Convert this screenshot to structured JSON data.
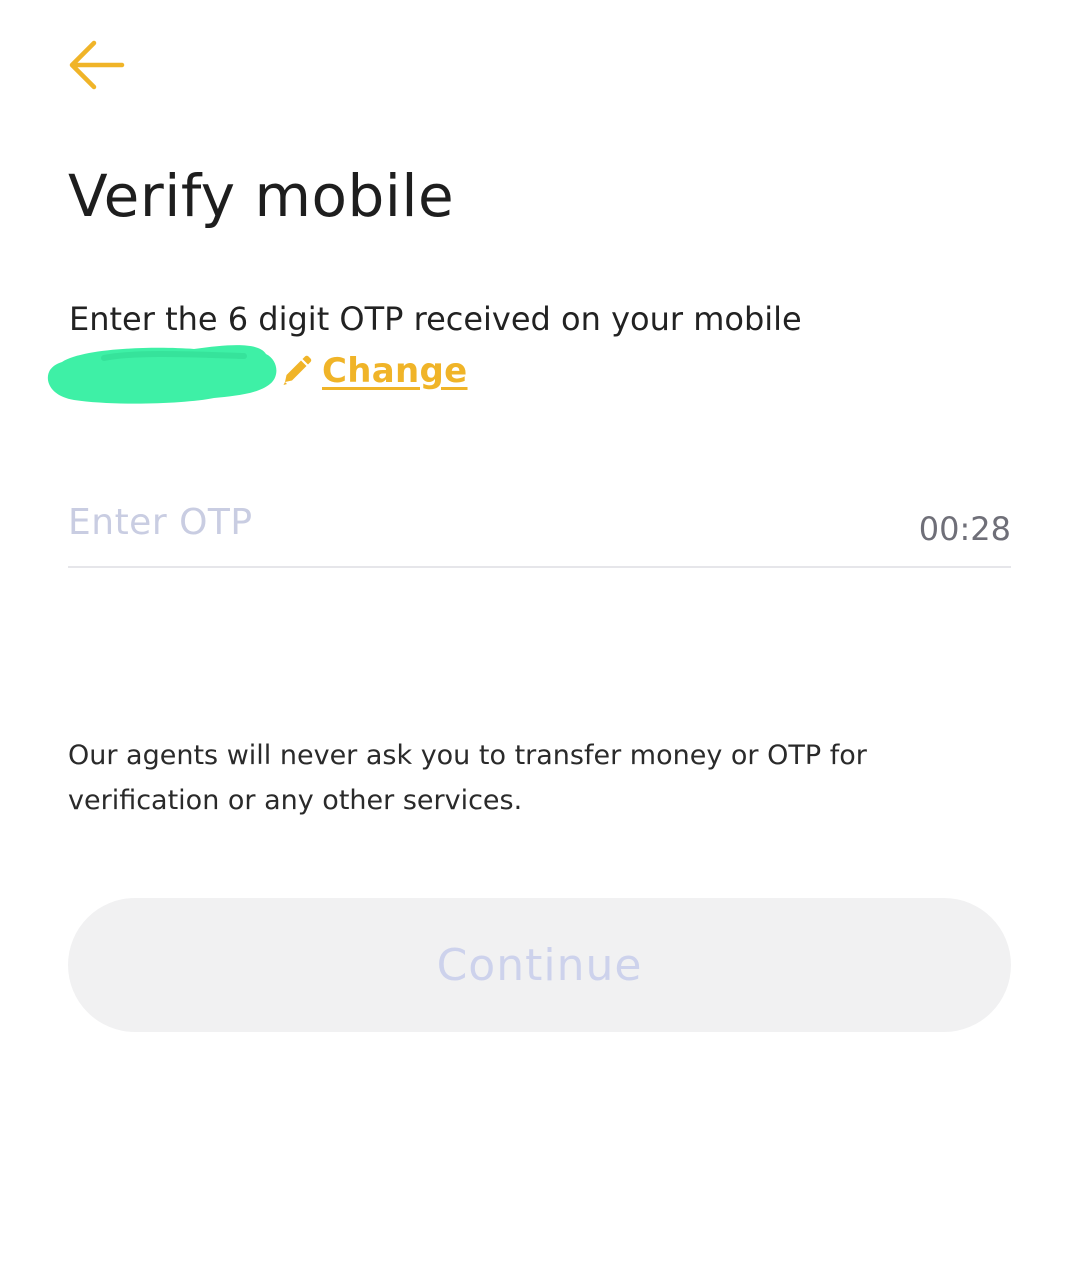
{
  "header": {
    "back_icon": "arrow-left-icon",
    "title": "Verify mobile"
  },
  "verification": {
    "instruction": "Enter the 6 digit OTP received on your mobile",
    "edit_icon": "pencil-icon",
    "change_label": "Change"
  },
  "otp": {
    "value": "",
    "placeholder": "Enter OTP",
    "timer": "00:28"
  },
  "disclaimer": "Our agents will never ask you to transfer money or OTP for verification or any other services.",
  "continue_button": {
    "label": "Continue",
    "enabled": false
  },
  "colors": {
    "accent": "#f0b428",
    "redaction": "#3ef0a6",
    "placeholder": "#c9cde2",
    "button_bg": "#f1f1f2",
    "button_text_disabled": "#cdd2ec"
  }
}
